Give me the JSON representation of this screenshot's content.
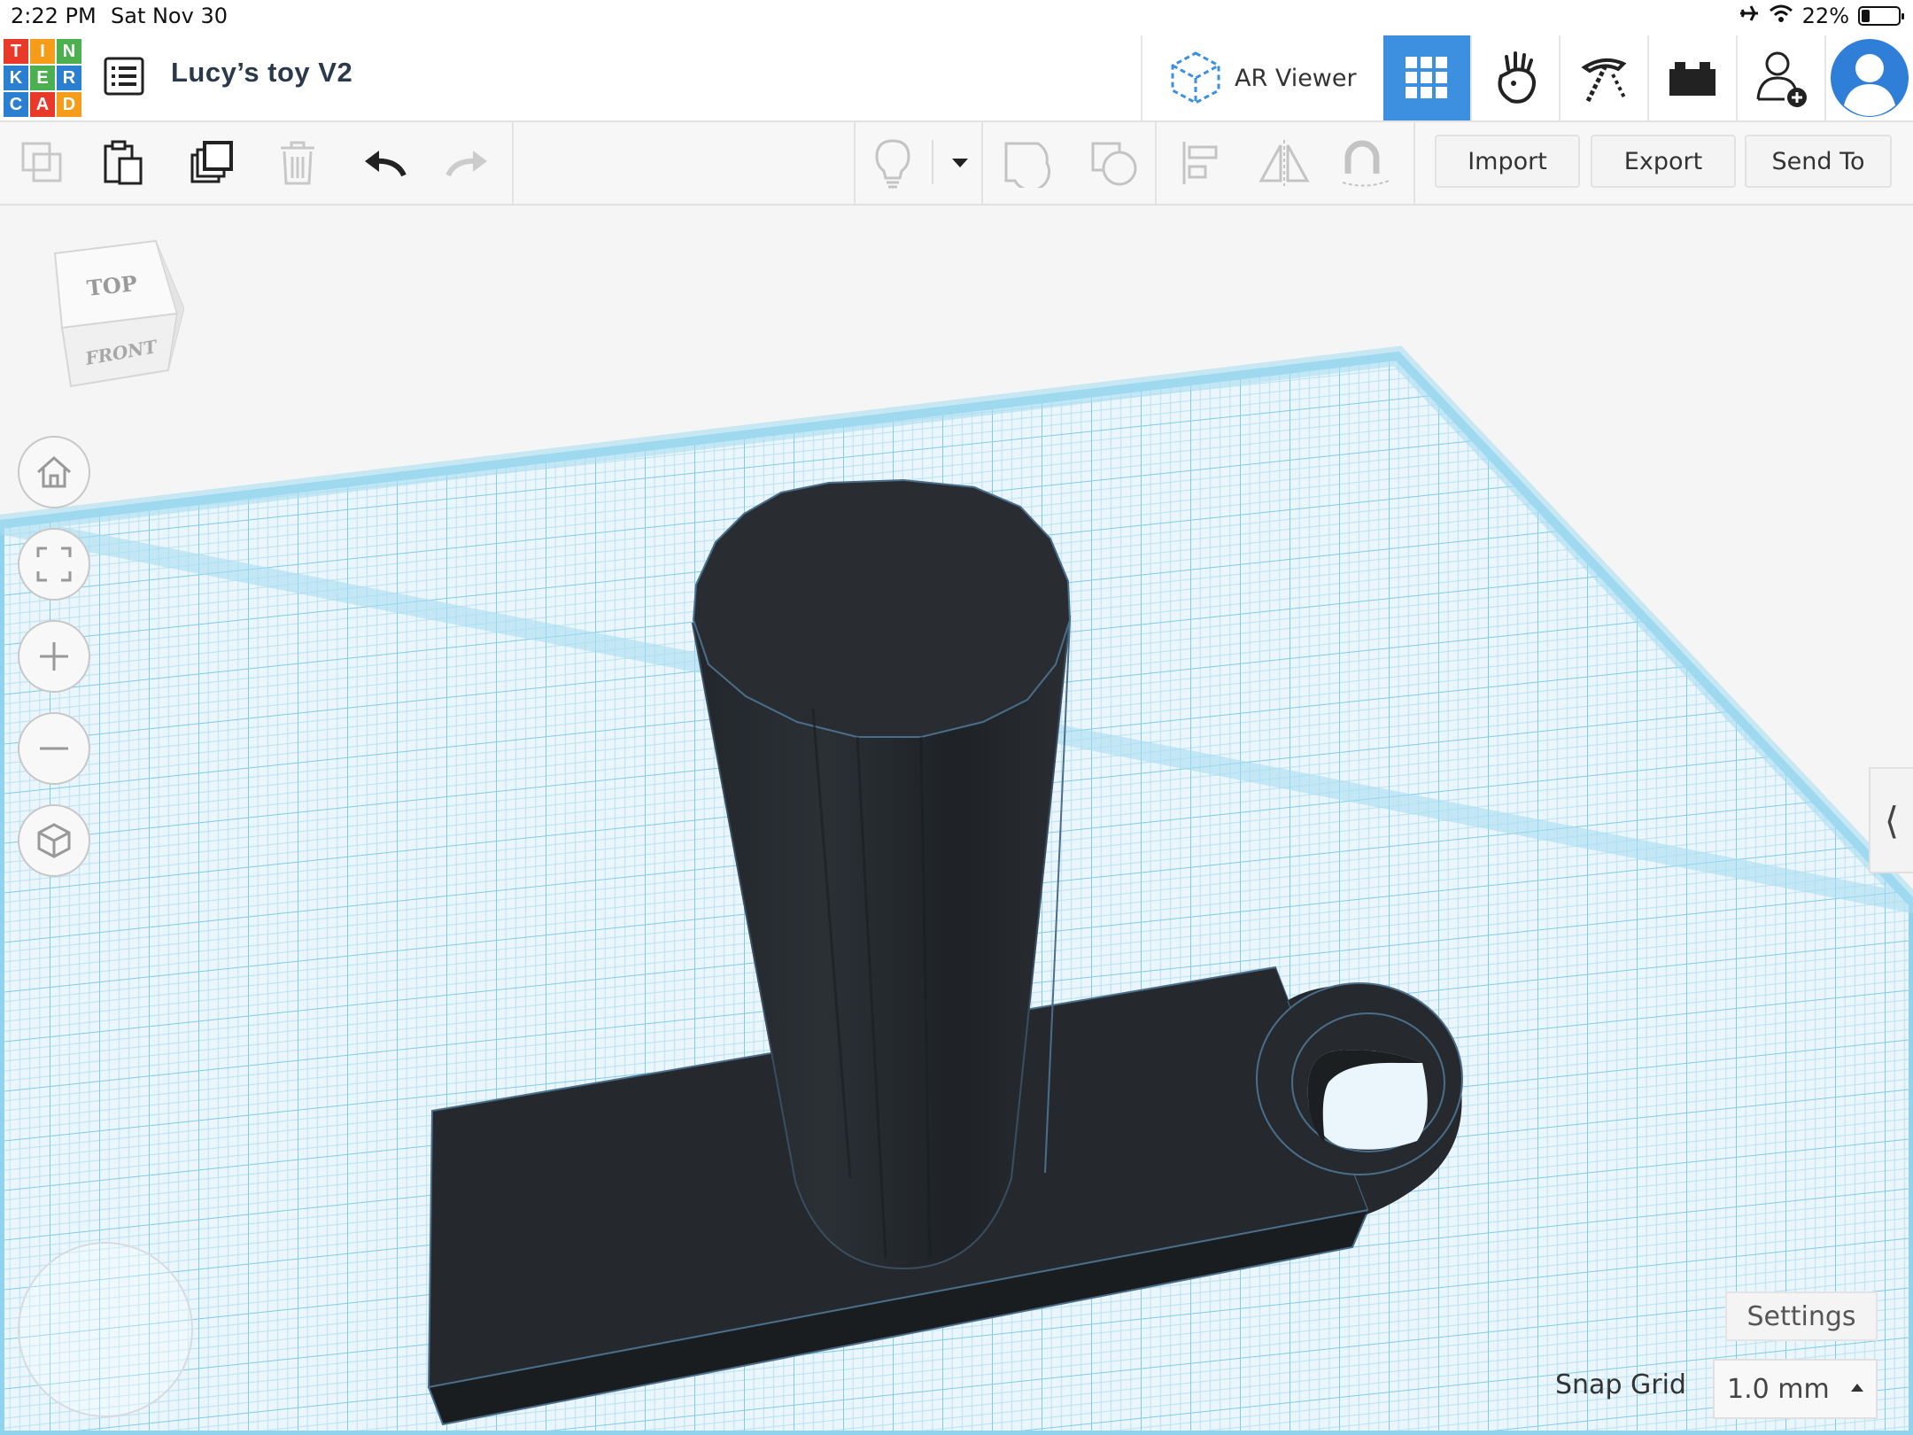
{
  "status_bar": {
    "time": "2:22 PM",
    "date": "Sat Nov 30",
    "battery": "22%",
    "icons": [
      "airplane-icon",
      "wifi-icon",
      "battery-icon"
    ]
  },
  "logo": {
    "letters": [
      "T",
      "I",
      "N",
      "K",
      "E",
      "R",
      "C",
      "A",
      "D"
    ],
    "colors": [
      "#e8392b",
      "#f59c1b",
      "#4caf50",
      "#2a7fd1",
      "#4caf50",
      "#2a7fd1",
      "#2a7fd1",
      "#e8392b",
      "#f59c1b"
    ]
  },
  "header": {
    "project_title": "Lucy’s toy V2",
    "ar_viewer_label": "AR Viewer",
    "buttons": [
      "3d-design-grid-icon",
      "blocks-icon",
      "bricks-icon",
      "lego-brick-icon",
      "add-user-icon",
      "user-avatar-icon"
    ],
    "active_color": "#3d8fe0"
  },
  "toolbar": {
    "import_label": "Import",
    "export_label": "Export",
    "send_to_label": "Send To"
  },
  "viewcube": {
    "top_label": "TOP",
    "front_label": "FRONT"
  },
  "workplane": {
    "grid_color": "#8fd3ee",
    "shape_color": "#272b30"
  },
  "bottom": {
    "settings_label": "Settings",
    "snap_grid_label": "Snap Grid",
    "snap_grid_value": "1.0 mm"
  }
}
